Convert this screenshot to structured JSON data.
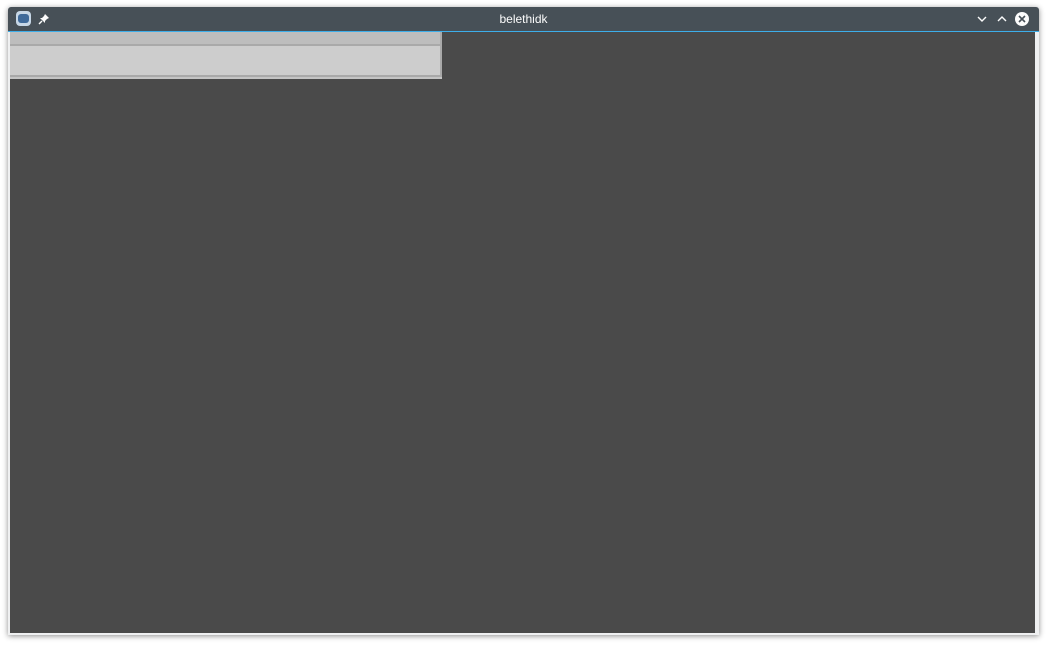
{
  "window": {
    "title": "belethidk"
  },
  "titlebar_icons": {
    "app": "app-icon",
    "pin": "pin-icon",
    "minimize": "chevron-down-icon",
    "maximize": "chevron-up-icon",
    "close": "close-icon"
  },
  "colors": {
    "titlebar": "#475057",
    "accent": "#3daee9",
    "content_background": "#4a4a4a",
    "panel": "#c4c4c4"
  }
}
